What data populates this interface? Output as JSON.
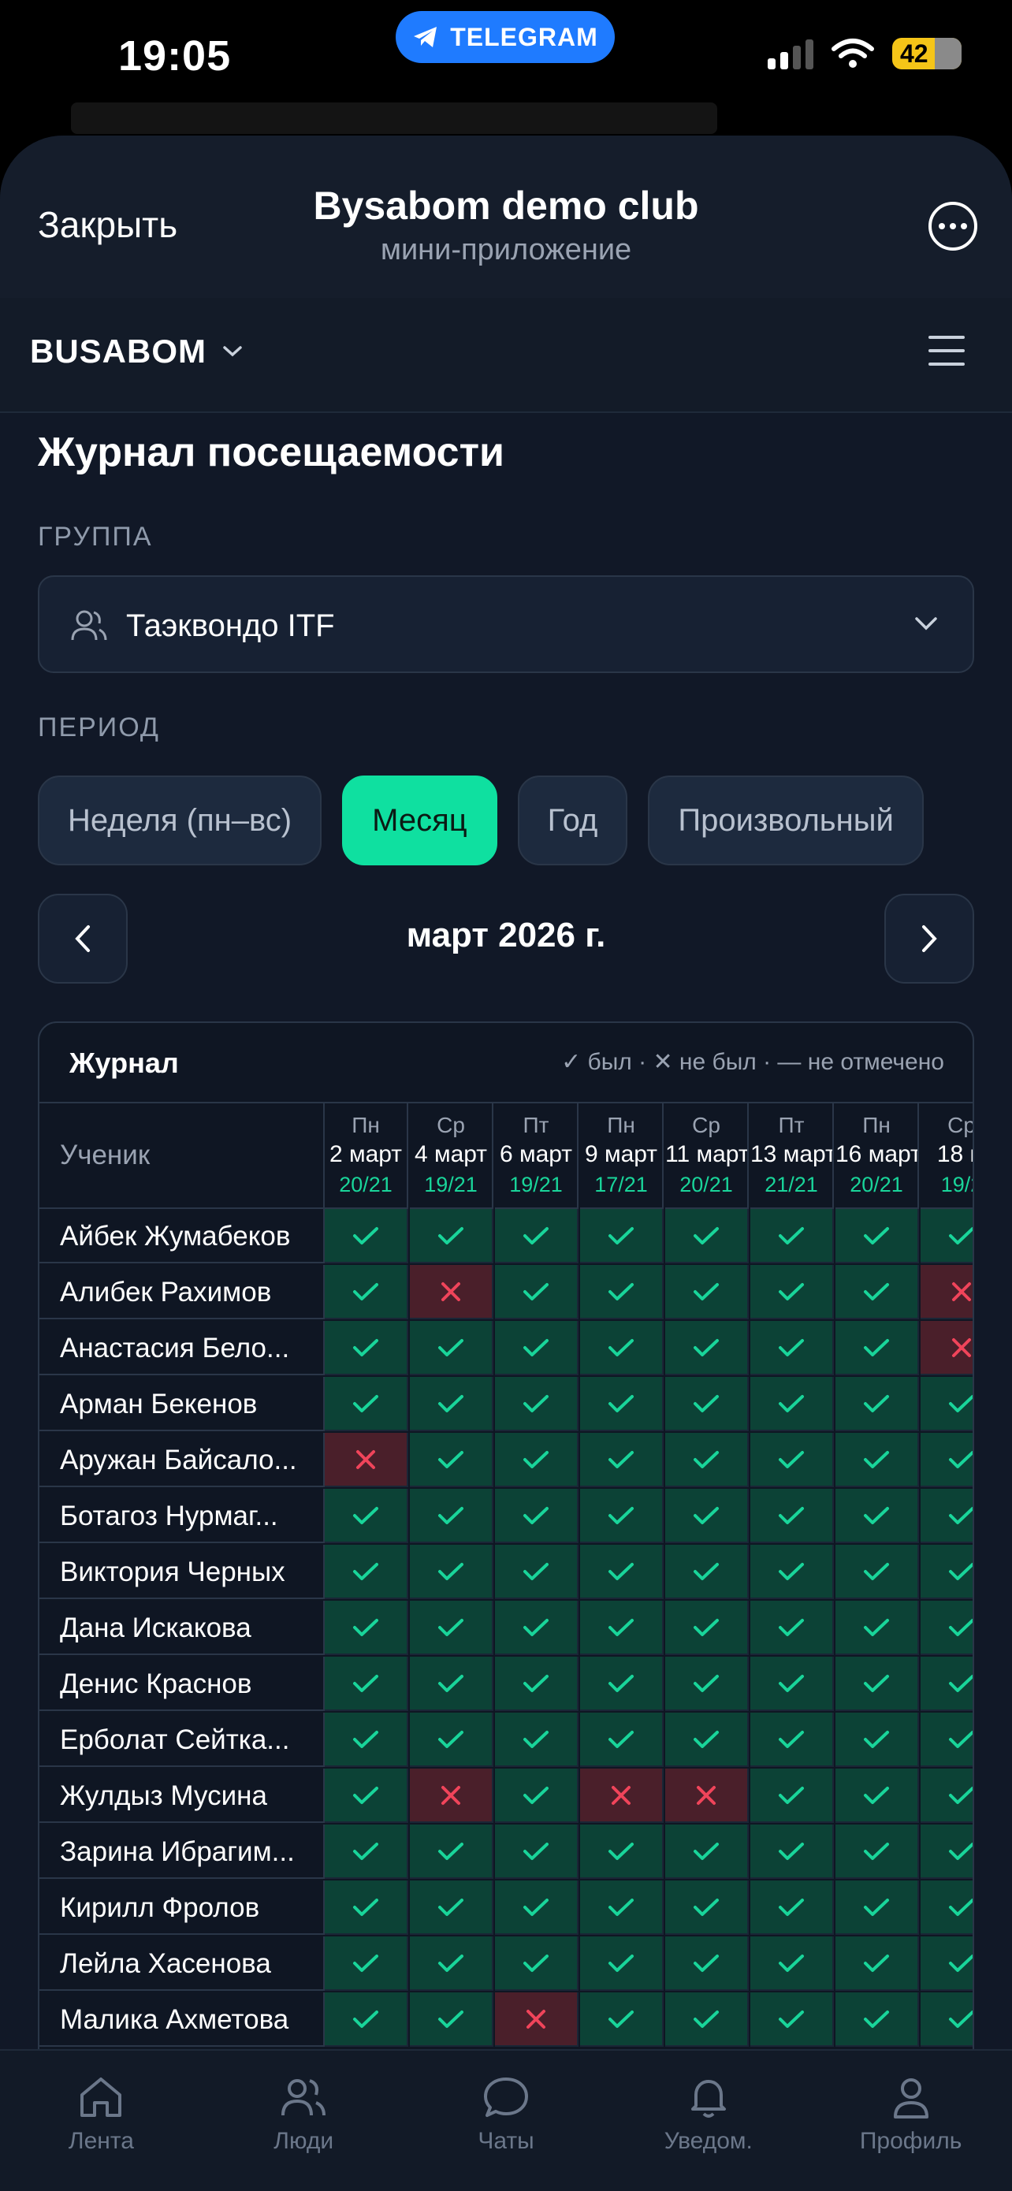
{
  "status": {
    "time": "19:05",
    "telegram": "TELEGRAM",
    "battery": "42"
  },
  "sheet": {
    "close": "Закрыть",
    "title": "Bysabom demo club",
    "subtitle": "мини-приложение"
  },
  "app": {
    "brand": "BUSABOM"
  },
  "page": {
    "title": "Журнал посещаемости",
    "group_label": "ГРУППА",
    "group_value": "Таэквондо ITF",
    "period_label": "ПЕРИОД",
    "periods": [
      "Неделя (пн–вс)",
      "Месяц",
      "Год",
      "Произвольный"
    ],
    "active_period": "Месяц",
    "month": "март 2026 г."
  },
  "journal": {
    "title": "Журнал",
    "legend": "✓ был · ✕ не был · — не отмечено",
    "student_header": "Ученик",
    "columns": [
      {
        "dow": "Пн",
        "date": "2 март",
        "count": "20/21"
      },
      {
        "dow": "Ср",
        "date": "4 март",
        "count": "19/21"
      },
      {
        "dow": "Пт",
        "date": "6 март",
        "count": "19/21"
      },
      {
        "dow": "Пн",
        "date": "9 март",
        "count": "17/21"
      },
      {
        "dow": "Ср",
        "date": "11 март",
        "count": "20/21"
      },
      {
        "dow": "Пт",
        "date": "13 март",
        "count": "21/21"
      },
      {
        "dow": "Пн",
        "date": "16 март",
        "count": "20/21"
      },
      {
        "dow": "Ср",
        "date": "18 м",
        "count": "19/2"
      }
    ],
    "rows": [
      {
        "name": "Айбек Жумабеков",
        "marks": [
          1,
          1,
          1,
          1,
          1,
          1,
          1,
          1
        ]
      },
      {
        "name": "Алибек Рахимов",
        "marks": [
          1,
          0,
          1,
          1,
          1,
          1,
          1,
          0
        ]
      },
      {
        "name": "Анастасия Бело...",
        "marks": [
          1,
          1,
          1,
          1,
          1,
          1,
          1,
          0
        ]
      },
      {
        "name": "Арман Бекенов",
        "marks": [
          1,
          1,
          1,
          1,
          1,
          1,
          1,
          1
        ]
      },
      {
        "name": "Аружан Байсало...",
        "marks": [
          0,
          1,
          1,
          1,
          1,
          1,
          1,
          1
        ]
      },
      {
        "name": "Ботагоз Нурмаг...",
        "marks": [
          1,
          1,
          1,
          1,
          1,
          1,
          1,
          1
        ]
      },
      {
        "name": "Виктория Черных",
        "marks": [
          1,
          1,
          1,
          1,
          1,
          1,
          1,
          1
        ]
      },
      {
        "name": "Дана Искакова",
        "marks": [
          1,
          1,
          1,
          1,
          1,
          1,
          1,
          1
        ]
      },
      {
        "name": "Денис Краснов",
        "marks": [
          1,
          1,
          1,
          1,
          1,
          1,
          1,
          1
        ]
      },
      {
        "name": "Ерболат Сейтка...",
        "marks": [
          1,
          1,
          1,
          1,
          1,
          1,
          1,
          1
        ]
      },
      {
        "name": "Жулдыз Мусина",
        "marks": [
          1,
          0,
          1,
          0,
          0,
          1,
          1,
          1
        ]
      },
      {
        "name": "Зарина Ибрагим...",
        "marks": [
          1,
          1,
          1,
          1,
          1,
          1,
          1,
          1
        ]
      },
      {
        "name": "Кирилл Фролов",
        "marks": [
          1,
          1,
          1,
          1,
          1,
          1,
          1,
          1
        ]
      },
      {
        "name": "Лейла Хасенова",
        "marks": [
          1,
          1,
          1,
          1,
          1,
          1,
          1,
          1
        ]
      },
      {
        "name": "Малика Ахметова",
        "marks": [
          1,
          1,
          0,
          1,
          1,
          1,
          1,
          1
        ]
      }
    ]
  },
  "tabs": [
    {
      "label": "Лента",
      "icon": "home-icon"
    },
    {
      "label": "Люди",
      "icon": "people-icon"
    },
    {
      "label": "Чаты",
      "icon": "chat-icon"
    },
    {
      "label": "Уведом.",
      "icon": "bell-icon"
    },
    {
      "label": "Профиль",
      "icon": "profile-icon"
    }
  ],
  "colors": {
    "accent": "#0fe0a0",
    "present_bg": "#0c4236",
    "absent_bg": "#4a1f2a",
    "check": "#19d59a",
    "cross": "#f0445a"
  }
}
